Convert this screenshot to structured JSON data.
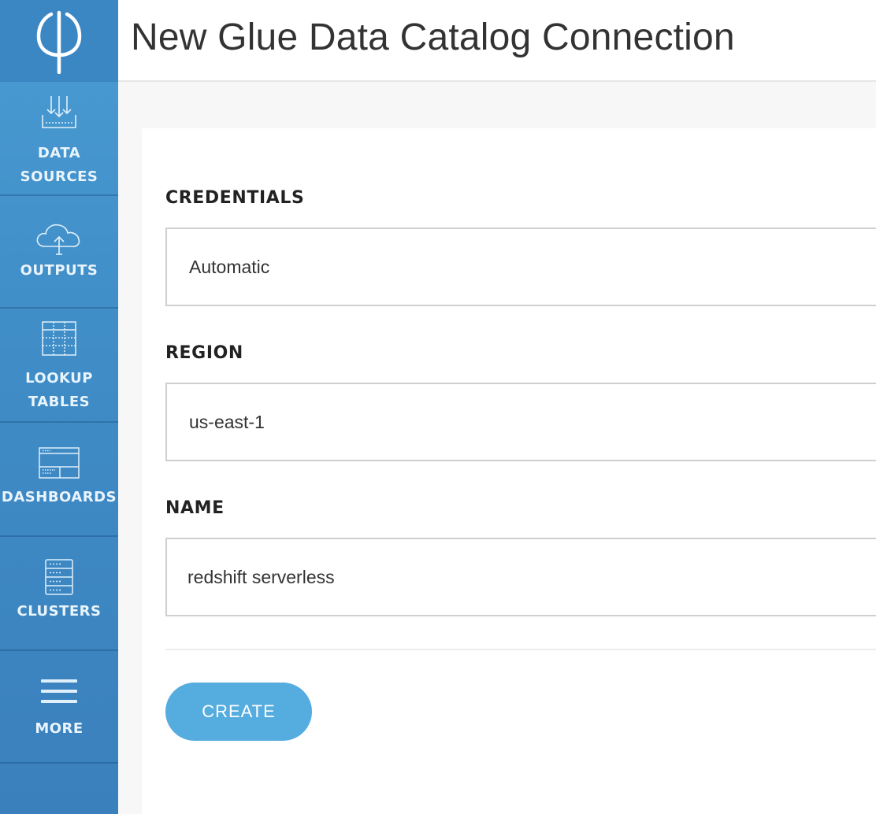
{
  "header": {
    "title": "New Glue Data Catalog Connection"
  },
  "sidebar": {
    "logo_icon": "phi-logo-icon",
    "items": [
      {
        "label": "DATA\nSOURCES",
        "icon": "data-sources-icon"
      },
      {
        "label": "OUTPUTS",
        "icon": "cloud-upload-icon"
      },
      {
        "label": "LOOKUP\nTABLES",
        "icon": "table-grid-icon"
      },
      {
        "label": "DASHBOARDS",
        "icon": "dashboard-icon"
      },
      {
        "label": "CLUSTERS",
        "icon": "server-rack-icon"
      },
      {
        "label": "MORE",
        "icon": "hamburger-menu-icon"
      }
    ]
  },
  "form": {
    "credentials": {
      "label": "CREDENTIALS",
      "value": "Automatic"
    },
    "region": {
      "label": "REGION",
      "value": "us-east-1"
    },
    "name": {
      "label": "NAME",
      "value": "redshift serverless"
    },
    "create_label": "CREATE"
  },
  "colors": {
    "sidebar": "#3f8cc6",
    "accent_button": "#55acdf",
    "nav_text": "#e9f4fc"
  }
}
